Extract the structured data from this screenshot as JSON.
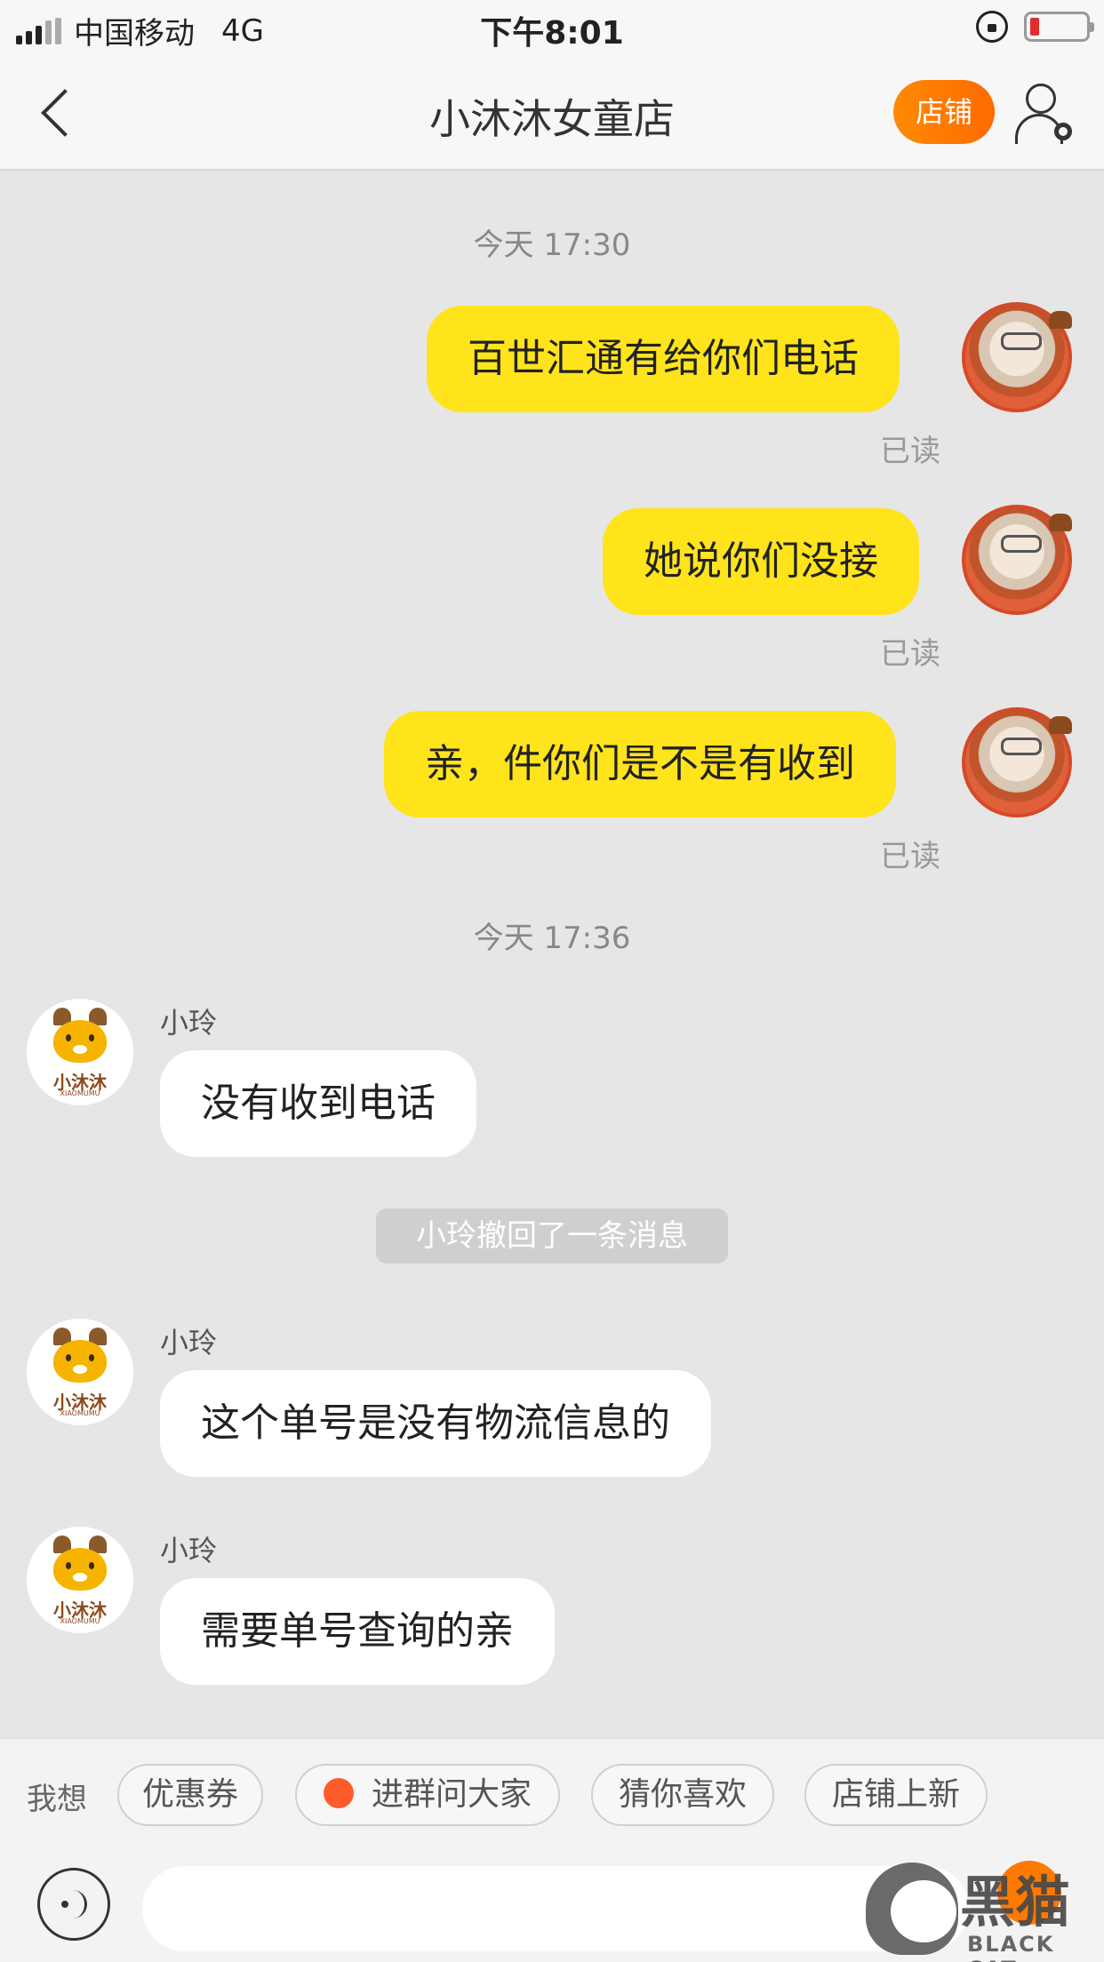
{
  "status_bar": {
    "carrier": "中国移动",
    "network": "4G",
    "time": "下午8:01"
  },
  "nav": {
    "title": "小沐沐女童店",
    "shop_button": "店铺"
  },
  "chat": {
    "time_1": "今天 17:30",
    "time_2": "今天 17:36",
    "read_label": "已读",
    "mine": [
      {
        "text": "百世汇通有给你们电话"
      },
      {
        "text": "她说你们没接"
      },
      {
        "text": "亲，件你们是不是有收到"
      }
    ],
    "shop_name": "小沐沐",
    "shop_name_sub": "XIAOMUMU",
    "sender": "小玲",
    "theirs": [
      {
        "text": "没有收到电话"
      },
      {
        "text": "这个单号是没有物流信息的"
      },
      {
        "text": "需要单号查询的亲"
      }
    ],
    "recall_notice": "小玲撤回了一条消息"
  },
  "quick_bar": {
    "label": "我想",
    "chips": [
      "优惠券",
      "进群问大家",
      "猜你喜欢",
      "店铺上新"
    ]
  },
  "input": {
    "placeholder": ""
  },
  "watermark": {
    "text": "黑猫",
    "sub": "BLACK CAT"
  }
}
